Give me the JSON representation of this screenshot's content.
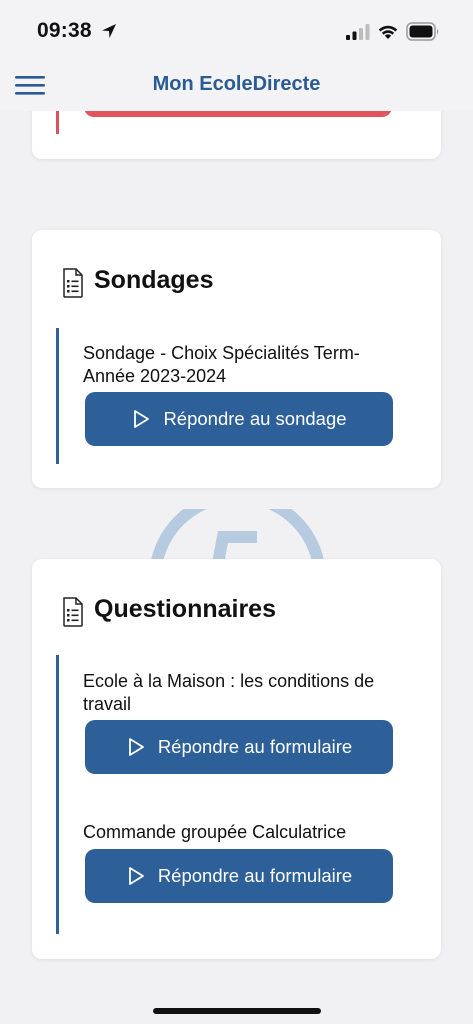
{
  "status_bar": {
    "time": "09:38"
  },
  "header": {
    "title": "Mon EcoleDirecte"
  },
  "colors": {
    "primary": "#2d6099",
    "title_blue": "#2a5b92",
    "alert_red": "#e0535f"
  },
  "sondages": {
    "title": "Sondages",
    "items": [
      {
        "text": "Sondage - Choix Spécialités Term-Année 2023-2024",
        "button_label": "Répondre au sondage"
      }
    ]
  },
  "questionnaires": {
    "title": "Questionnaires",
    "items": [
      {
        "text": "Ecole à la Maison : les conditions de travail",
        "button_label": "Répondre au formulaire"
      },
      {
        "text": "Commande groupée Calculatrice",
        "button_label": "Répondre au formulaire"
      }
    ]
  }
}
